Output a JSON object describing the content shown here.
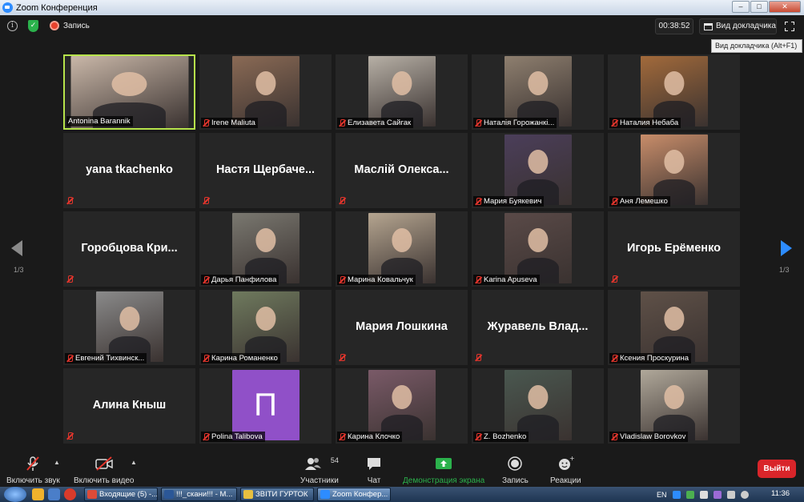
{
  "window": {
    "title": "Zoom Конференция"
  },
  "topbar": {
    "record_label": "Запись",
    "timer": "00:38:52",
    "speaker_view_label": "Вид докладчика",
    "tooltip": "Вид докладчика (Alt+F1)"
  },
  "pagination": {
    "left": "1/3",
    "right": "1/3"
  },
  "participants": [
    {
      "name": "Antonina Barannik",
      "video": true,
      "active": true,
      "bg": "#c9b7a8"
    },
    {
      "name": "Irene Maliuta",
      "video": true,
      "bg": "#8a6a55"
    },
    {
      "name": "Елизавета Сайгак",
      "video": true,
      "bg": "#b7b0a6"
    },
    {
      "name": "Наталія Горожанкі...",
      "video": true,
      "bg": "#8e7f6f"
    },
    {
      "name": "Наталия Небаба",
      "video": true,
      "bg": "#a26a3b"
    },
    {
      "name": "yana tkachenko",
      "video": false,
      "display": "yana tkachenko"
    },
    {
      "name": "Настя Щербаче...",
      "video": false,
      "display": "Настя  Щербаче..."
    },
    {
      "name": "Маслій Олекса...",
      "video": false,
      "display": "Маслій  Олекса..."
    },
    {
      "name": "Мария Буякевич",
      "video": true,
      "bg": "#4b3e5a"
    },
    {
      "name": "Аня Лемешко",
      "video": true,
      "bg": "#c88d6a"
    },
    {
      "name": "Горобцова Кри...",
      "video": false,
      "display": "Горобцова  Кри..."
    },
    {
      "name": "Дарья Панфилова",
      "video": true,
      "bg": "#7a7870"
    },
    {
      "name": "Марина Ковальчук",
      "video": true,
      "bg": "#b5a590"
    },
    {
      "name": "Karina Apuseva",
      "video": true,
      "bg": "#5a4a48"
    },
    {
      "name": "Игорь Ерёменко",
      "video": false,
      "display": "Игорь  Ерёменко"
    },
    {
      "name": "Евгений Тихвинск...",
      "video": true,
      "bg": "#8a8a8a"
    },
    {
      "name": "Карина Романенко",
      "video": true,
      "bg": "#6f7a5e"
    },
    {
      "name": "Мария Лошкина",
      "video": false,
      "display": "Мария  Лошкина"
    },
    {
      "name": "Журавель Влад...",
      "video": false,
      "display": "Журавель  Влад..."
    },
    {
      "name": "Ксения Проскурина",
      "video": true,
      "bg": "#5f5148"
    },
    {
      "name": "Алина Кныш",
      "video": false,
      "display": "Алина  Кныш"
    },
    {
      "name": "Polina Talibova",
      "video": true,
      "bg": "#9050c8",
      "letter": "П"
    },
    {
      "name": "Карина Клочко",
      "video": true,
      "bg": "#7a5a68"
    },
    {
      "name": "Z. Bozhenko",
      "video": true,
      "bg": "#4a5850"
    },
    {
      "name": "Vladislaw Borovkov",
      "video": true,
      "bg": "#b0a89a"
    }
  ],
  "toolbar": {
    "audio_label": "Включить звук",
    "video_label": "Включить видео",
    "participants_count": "54",
    "participants_label": "Участники",
    "chat_label": "Чат",
    "share_label": "Демонстрация экрана",
    "record_label": "Запись",
    "reactions_label": "Реакции",
    "leave_label": "Выйти"
  },
  "colors": {
    "active_border": "#b6e34b",
    "share_green": "#2bb24c",
    "leave_red": "#d9252a",
    "accent_blue": "#2d8cff"
  },
  "taskbar": {
    "apps": [
      {
        "label": "Входящие (5) -...",
        "color": "#dd4b39"
      },
      {
        "label": "!!!_скани!!! - M...",
        "color": "#2b5797"
      },
      {
        "label": "ЗВІТИ ГУРТОК",
        "color": "#e8c040"
      },
      {
        "label": "Zoom Конфер...",
        "color": "#2d8cff",
        "active": true
      }
    ],
    "lang": "EN",
    "time": "11:36"
  }
}
